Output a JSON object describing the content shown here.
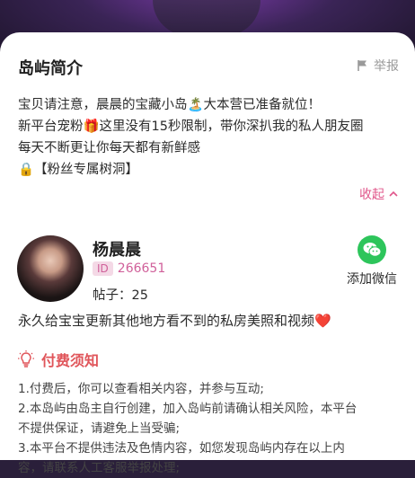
{
  "header": {
    "title": "岛屿简介",
    "report_label": "举报"
  },
  "description": {
    "lines": [
      "宝贝请注意，晨晨的宝藏小岛🏝️大本营已准备就位！",
      "新平台宠粉🎁这里没有15秒限制，带你深扒我的私人朋友圈",
      "每天不断更让你每天都有新鲜感",
      "🔒【粉丝专属树洞】"
    ],
    "collapse_label": "收起"
  },
  "profile": {
    "name": "杨晨晨",
    "id_badge": "ID",
    "id_value": "266651",
    "posts_label": "帖子：25",
    "wechat_label": "添加微信"
  },
  "tagline": "永久给宝宝更新其他地方看不到的私房美照和视频❤️",
  "fee_notice": {
    "title": "付费须知",
    "items": [
      "1.付费后，你可以查看相关内容，并参与互动;",
      "2.本岛屿由岛主自行创建，加入岛屿前请确认相关风险，本平台",
      "不提供保证，请避免上当受骗;",
      "3.本平台不提供违法及色情内容，如您发现岛屿内存在以上内",
      "容，请联系人工客服举报处理;"
    ]
  },
  "colors": {
    "accent_pink": "#e0558a",
    "wechat_green": "#2dc55b",
    "fee_red": "#e0555a"
  }
}
